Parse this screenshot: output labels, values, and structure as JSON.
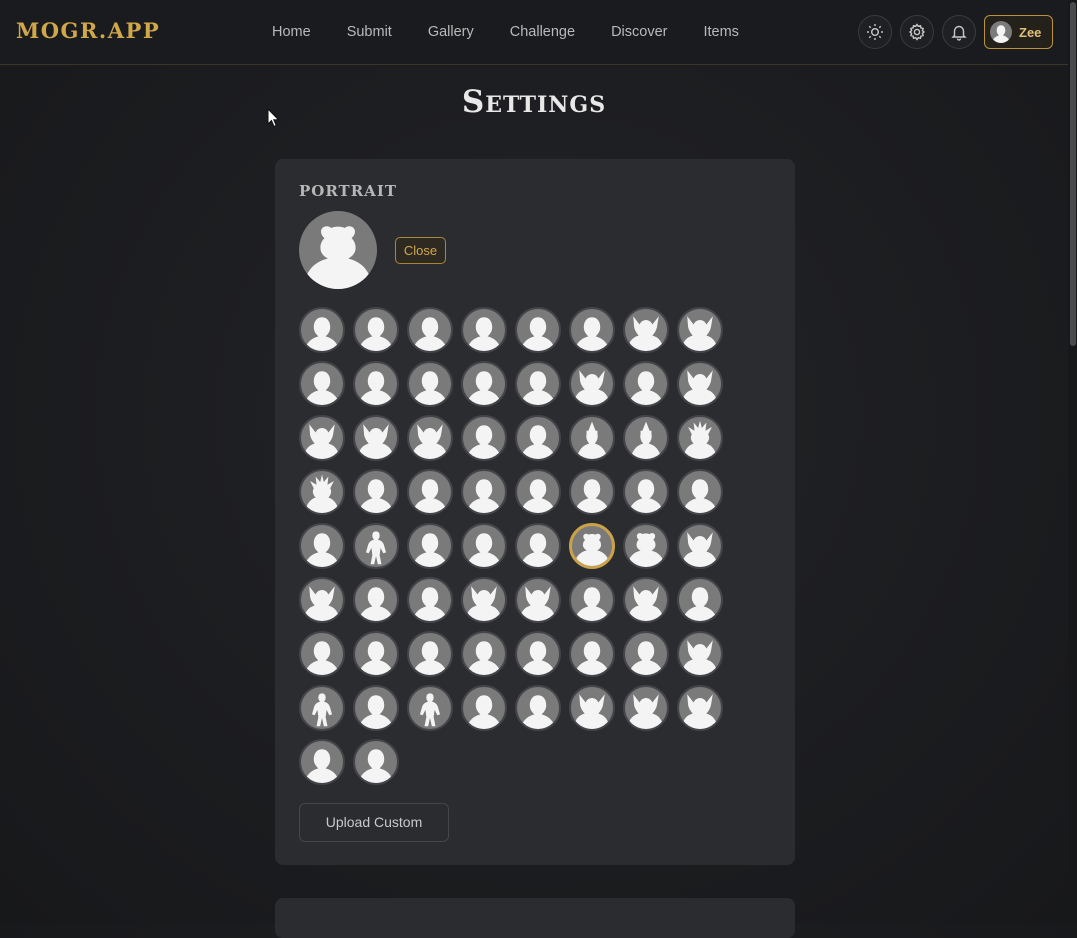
{
  "brand": {
    "name": "MOGR.APP"
  },
  "nav": {
    "items": [
      "Home",
      "Submit",
      "Gallery",
      "Challenge",
      "Discover",
      "Items"
    ]
  },
  "header": {
    "icons": [
      "sun-icon",
      "gear-icon",
      "bell-icon"
    ],
    "user": {
      "name": "Zee"
    }
  },
  "page": {
    "title": "Settings"
  },
  "portrait_section": {
    "title": "PORTRAIT",
    "close_label": "Close",
    "upload_label": "Upload Custom",
    "selected_index": 37,
    "portraits": [
      "bust",
      "bust",
      "bust",
      "bust",
      "bust",
      "bust",
      "horned",
      "horned",
      "bust",
      "bust",
      "bust",
      "bust",
      "bust",
      "horned",
      "bust",
      "horned",
      "horned",
      "horned",
      "horned",
      "bust",
      "bust",
      "hat",
      "hat",
      "spiky",
      "spiky",
      "bust",
      "bust",
      "bust",
      "bust",
      "bust",
      "bust",
      "bust",
      "bust",
      "full-body",
      "bust",
      "bust",
      "bust",
      "bear",
      "bear",
      "horned",
      "horned",
      "bust",
      "bust",
      "horned",
      "horned",
      "bust",
      "horned",
      "bust",
      "bust",
      "bust",
      "bust",
      "bust",
      "bust",
      "bust",
      "bust",
      "horned",
      "full-body",
      "bust",
      "full-body",
      "bust",
      "bust",
      "horned",
      "horned",
      "horned",
      "bust",
      "bust"
    ]
  },
  "colors": {
    "accent": "#c9a24a",
    "background": "#1c1d20",
    "card": "#2b2c30",
    "portrait_bg": "#7a7a7a"
  }
}
